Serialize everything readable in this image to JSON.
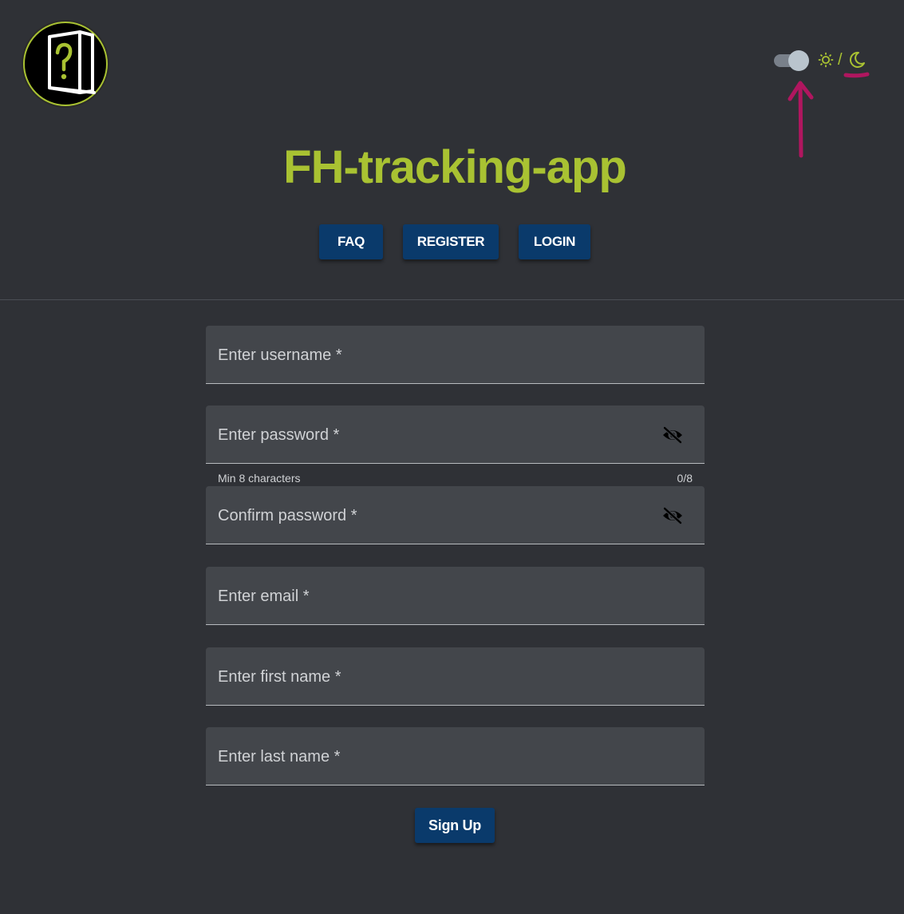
{
  "header": {
    "title": "FH-tracking-app",
    "theme_toggle": {
      "state": "on",
      "separator": "/",
      "icons": [
        "sun-icon",
        "moon-icon"
      ],
      "accent_color": "#a9c232"
    },
    "logo_icon": "door-question-icon"
  },
  "nav": {
    "faq_label": "FAQ",
    "register_label": "REGISTER",
    "login_label": "LOGIN",
    "button_color": "#0a3a6b"
  },
  "form": {
    "username_label": "Enter username *",
    "password_label": "Enter password *",
    "password_hint": "Min 8 characters",
    "password_counter": "0/8",
    "confirm_password_label": "Confirm password *",
    "email_label": "Enter email *",
    "first_name_label": "Enter first name *",
    "last_name_label": "Enter last name *",
    "visibility_icon": "eye-off-icon",
    "submit_label": "Sign Up"
  },
  "annotation": {
    "color": "#b0165f",
    "shapes": [
      "arrow",
      "underline"
    ]
  }
}
